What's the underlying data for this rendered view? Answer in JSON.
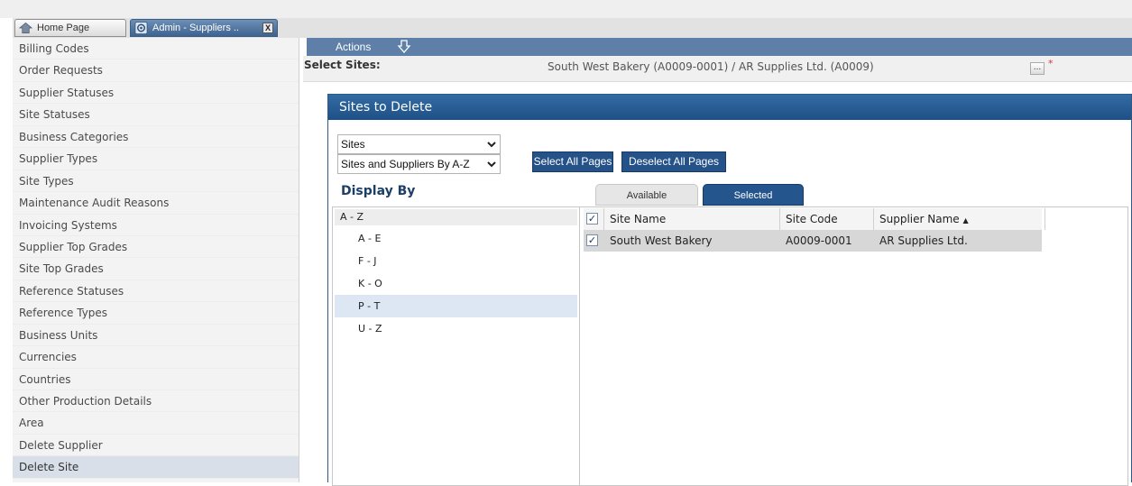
{
  "tabs": [
    {
      "label": "Home Page",
      "icon": "home-icon"
    },
    {
      "label": "Admin - Suppliers ..",
      "icon": "gear-icon",
      "close": "X"
    }
  ],
  "sidebar": {
    "items": [
      {
        "label": "Billing Codes"
      },
      {
        "label": "Order Requests"
      },
      {
        "label": "Supplier Statuses"
      },
      {
        "label": "Site Statuses"
      },
      {
        "label": "Business Categories"
      },
      {
        "label": "Supplier Types"
      },
      {
        "label": "Site Types"
      },
      {
        "label": "Maintenance Audit Reasons"
      },
      {
        "label": "Invoicing Systems"
      },
      {
        "label": "Supplier Top Grades"
      },
      {
        "label": "Site Top Grades"
      },
      {
        "label": "Reference Statuses"
      },
      {
        "label": "Reference Types"
      },
      {
        "label": "Business Units"
      },
      {
        "label": "Currencies"
      },
      {
        "label": "Countries"
      },
      {
        "label": "Other Production Details"
      },
      {
        "label": "Area"
      },
      {
        "label": "Delete Supplier"
      },
      {
        "label": "Delete Site",
        "active": true
      }
    ]
  },
  "toolbar": {
    "actions_label": "Actions"
  },
  "select_sites": {
    "label": "Select Sites:",
    "value": "South West Bakery (A0009-0001) / AR Supplies Ltd. (A0009)",
    "button_label": "...",
    "required_mark": "*"
  },
  "panel": {
    "title": "Sites to Delete",
    "dropdown1": "Sites",
    "dropdown2": "Sites and Suppliers By A-Z",
    "select_all_label": "Select All Pages",
    "deselect_all_label": "Deselect All Pages",
    "display_by_label": "Display By",
    "tabs": {
      "available": "Available",
      "selected": "Selected"
    },
    "az": {
      "header": "A - Z",
      "items": [
        "A - E",
        "F - J",
        "K - O",
        "P - T",
        "U - Z"
      ],
      "active_index": 3
    },
    "grid": {
      "columns": [
        "Site Name",
        "Site Code",
        "Supplier Name"
      ],
      "sort_indicator": "▲",
      "rows": [
        {
          "site_name": "South West Bakery",
          "site_code": "A0009-0001",
          "supplier_name": "AR Supplies Ltd.",
          "checked": true
        }
      ]
    }
  },
  "colors": {
    "accent": "#245289",
    "header": "#1e5087",
    "actions_bar": "#5e80a8"
  }
}
